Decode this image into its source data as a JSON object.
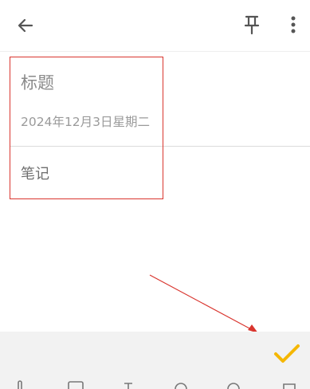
{
  "note": {
    "title_placeholder": "标题",
    "date": "2024年12月3日星期二",
    "body_placeholder": "笔记"
  },
  "icons": {
    "back": "arrow-back-icon",
    "pin": "pin-icon",
    "more": "more-vert-icon",
    "confirm": "checkmark-icon"
  },
  "colors": {
    "accent": "#F5B700",
    "annotation": "#D9352E",
    "text_hint": "#8A8A8A"
  }
}
